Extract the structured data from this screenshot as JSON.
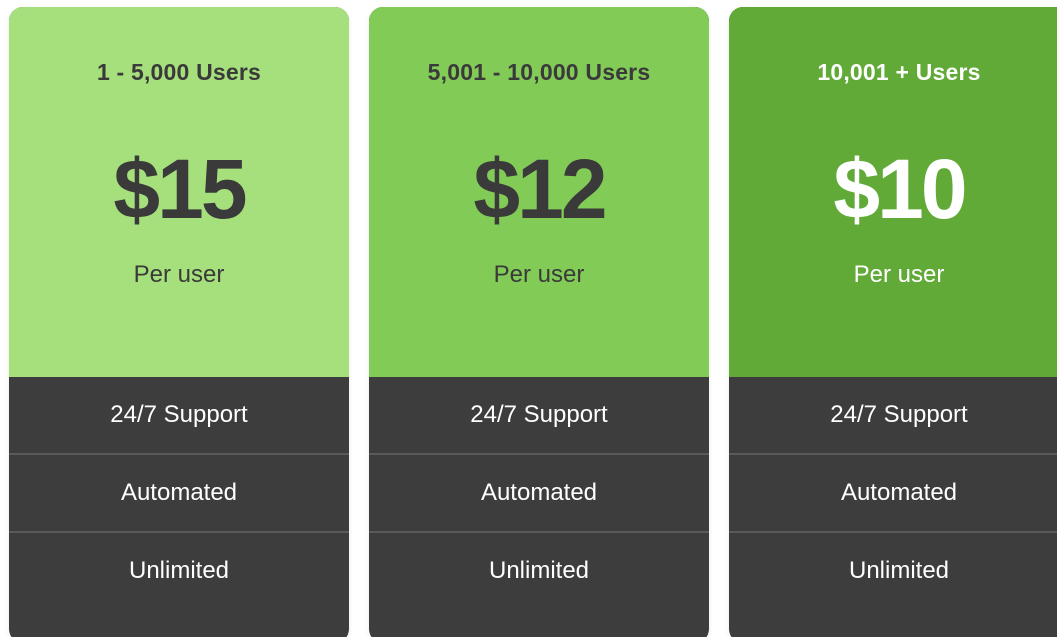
{
  "plans": [
    {
      "tier": "1 - 5,000 Users",
      "price": "$15",
      "per": "Per user",
      "bg": "#a6e07c",
      "text_color": "#3a3a3a",
      "features": [
        "24/7 Support",
        "Automated",
        "Unlimited"
      ]
    },
    {
      "tier": "5,001 - 10,000 Users",
      "price": "$12",
      "per": "Per user",
      "bg": "#83cb57",
      "text_color": "#3a3a3a",
      "features": [
        "24/7 Support",
        "Automated",
        "Unlimited"
      ]
    },
    {
      "tier": "10,001 + Users",
      "price": "$10",
      "per": "Per user",
      "bg": "#62aa38",
      "text_color": "#ffffff",
      "features": [
        "24/7 Support",
        "Automated",
        "Unlimited"
      ]
    }
  ]
}
